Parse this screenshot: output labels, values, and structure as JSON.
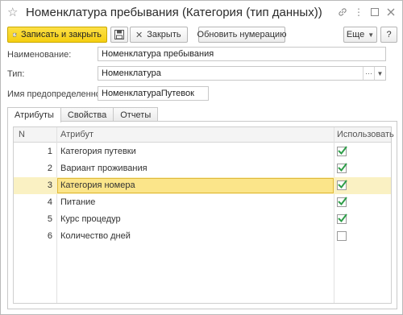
{
  "window": {
    "title": "Номенклатура пребывания (Категория (тип данных))",
    "controls": [
      "link-icon",
      "more-icon",
      "maximize-icon",
      "close-icon"
    ]
  },
  "toolbar": {
    "save_close_label": "Записать и закрыть",
    "close_label": "Закрыть",
    "renumber_label": "Обновить нумерацию",
    "more_label": "Еще",
    "help_label": "?"
  },
  "fields": {
    "name_label": "Наименование:",
    "name_value": "Номенклатура пребывания",
    "type_label": "Тип:",
    "type_value": "Номенклатура",
    "predef_label": "Имя предопределенного:",
    "predef_value": "НоменклатураПутевок"
  },
  "tabs": [
    "Атрибуты",
    "Свойства",
    "Отчеты"
  ],
  "table": {
    "col_n": "N",
    "col_attr": "Атрибут",
    "col_use": "Использовать",
    "rows": [
      {
        "n": "1",
        "attr": "Категория путевки",
        "use": true
      },
      {
        "n": "2",
        "attr": "Вариант проживания",
        "use": true
      },
      {
        "n": "3",
        "attr": "Категория номера",
        "use": true
      },
      {
        "n": "4",
        "attr": "Питание",
        "use": true
      },
      {
        "n": "5",
        "attr": "Курс процедур",
        "use": true
      },
      {
        "n": "6",
        "attr": "Количество дней",
        "use": false
      }
    ],
    "selected_row": 3
  },
  "colors": {
    "primary_button": "#f5cf10",
    "selected_row": "#faf1c3",
    "selected_cell": "#fbe58a",
    "check": "#2e9e49"
  }
}
